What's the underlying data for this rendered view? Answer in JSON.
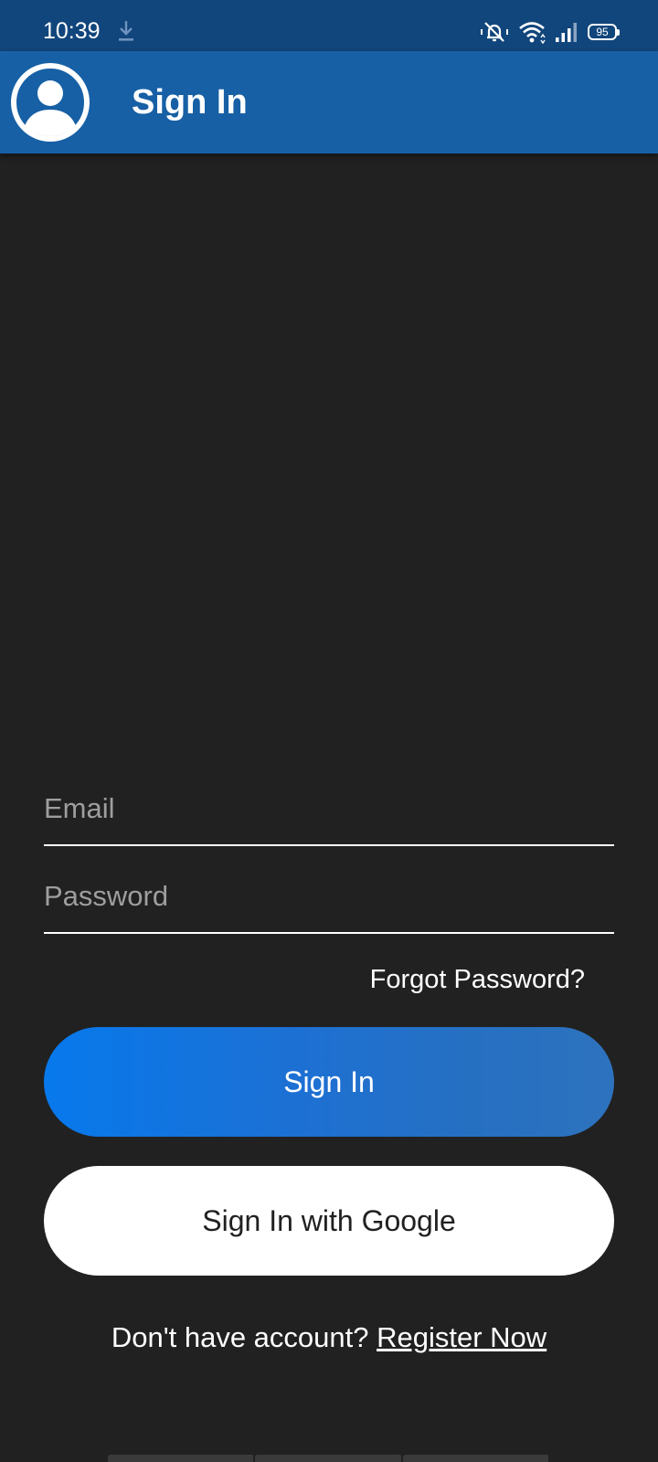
{
  "status_bar": {
    "time": "10:39",
    "battery": "95",
    "icons": [
      "download-icon",
      "mute-icon",
      "wifi-icon",
      "signal-icon",
      "battery-icon"
    ]
  },
  "app_bar": {
    "title": "Sign In",
    "avatar_icon": "account-circle-icon",
    "background": "#1760a5"
  },
  "form": {
    "email_placeholder": "Email",
    "email_value": "",
    "password_placeholder": "Password",
    "password_value": "",
    "forgot_label": "Forgot Password?",
    "sign_in_label": "Sign In",
    "google_label": "Sign In with Google"
  },
  "footer": {
    "prompt": "Don't have account?",
    "register_label": "Register Now"
  },
  "colors": {
    "background": "#212121",
    "status_bar": "#11467c",
    "accent_start": "#0779ec",
    "accent_end": "#2d72be"
  }
}
